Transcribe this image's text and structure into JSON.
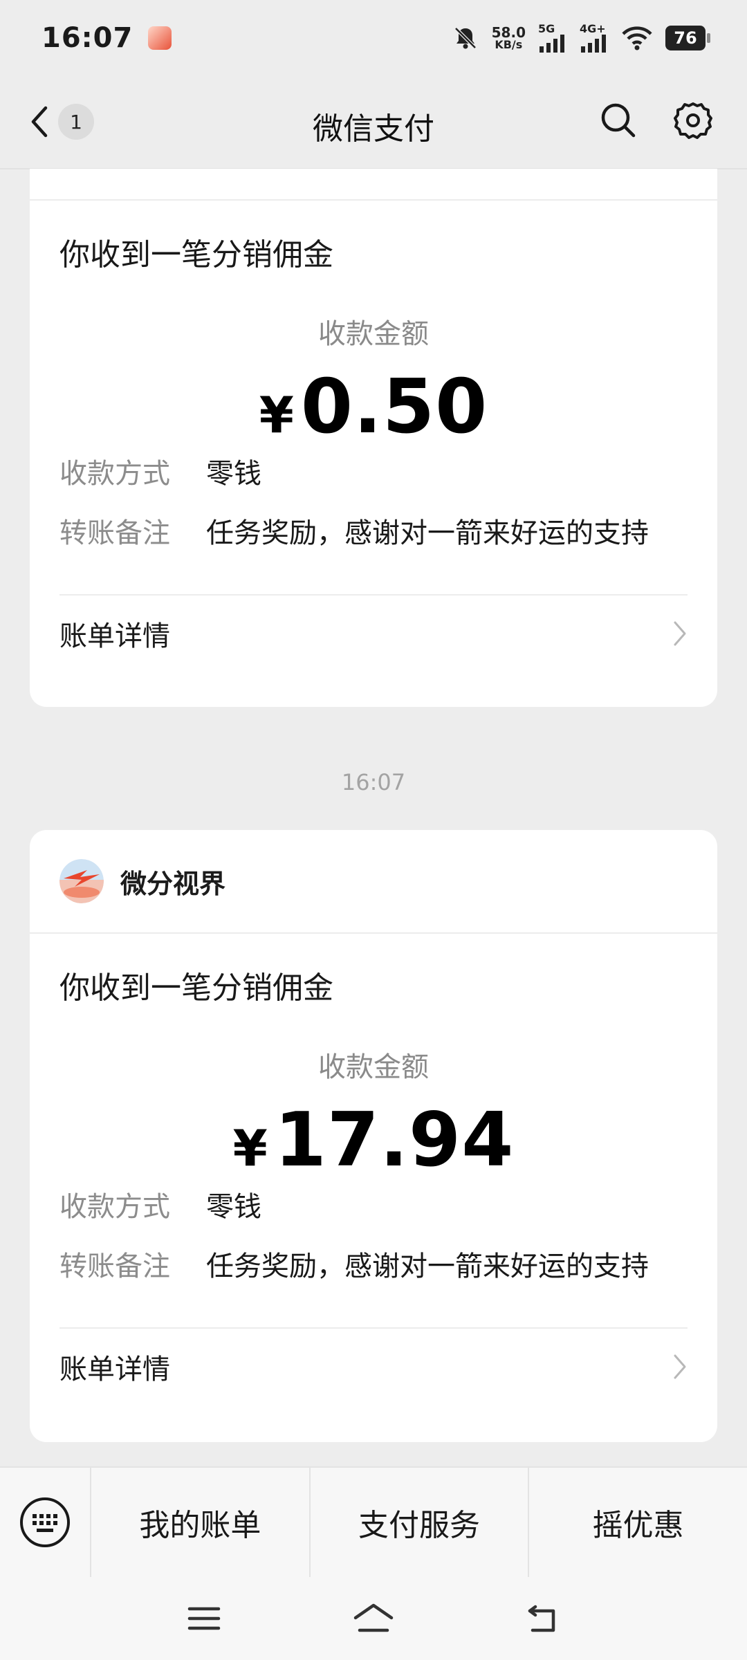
{
  "status_bar": {
    "time": "16:07",
    "net_speed_value": "58.0",
    "net_speed_unit": "KB/s",
    "signal1_label": "5G",
    "signal2_label": "4G+",
    "battery": "76"
  },
  "header": {
    "back_badge": "1",
    "title": "微信支付"
  },
  "messages": [
    {
      "title": "你收到一笔分销佣金",
      "amount_label": "收款金额",
      "currency_symbol": "¥",
      "amount": "0.50",
      "method_key": "收款方式",
      "method_value": "零钱",
      "note_key": "转账备注",
      "note_value": "任务奖励，感谢对一箭来好运的支持",
      "detail_label": "账单详情"
    },
    {
      "sender": "微分视界",
      "title": "你收到一笔分销佣金",
      "amount_label": "收款金额",
      "currency_symbol": "¥",
      "amount": "17.94",
      "method_key": "收款方式",
      "method_value": "零钱",
      "note_key": "转账备注",
      "note_value": "任务奖励，感谢对一箭来好运的支持",
      "detail_label": "账单详情"
    }
  ],
  "timestamp": "16:07",
  "menu": {
    "items": [
      "我的账单",
      "支付服务",
      "摇优惠"
    ]
  },
  "icons": {
    "back": "chevron-left-icon",
    "search": "search-icon",
    "settings": "gear-icon",
    "keyboard": "keyboard-icon",
    "chevron": "chevron-right-icon",
    "nav_menu": "menu-icon",
    "nav_home": "home-icon",
    "nav_back": "back-icon"
  }
}
